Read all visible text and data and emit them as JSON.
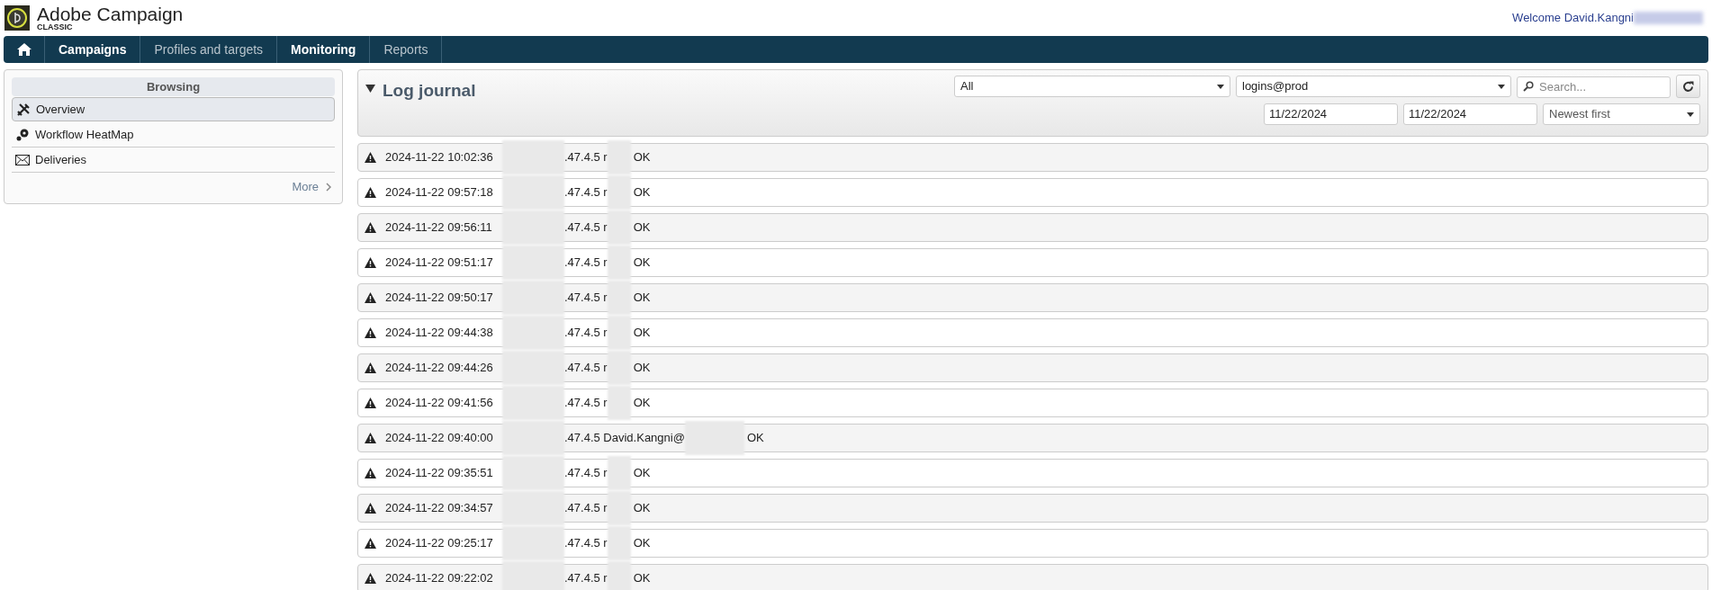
{
  "app": {
    "name": "Adobe Campaign",
    "edition": "CLASSIC"
  },
  "welcome": "Welcome David.Kangni",
  "nav": [
    {
      "kind": "home"
    },
    {
      "label": "Campaigns",
      "active": true
    },
    {
      "label": "Profiles and targets",
      "active": false
    },
    {
      "label": "Monitoring",
      "active": true
    },
    {
      "label": "Reports",
      "active": false
    }
  ],
  "sidebar": {
    "title": "Browsing",
    "items": [
      {
        "kind": "tools",
        "label": "Overview",
        "selected": true
      },
      {
        "kind": "gears",
        "label": "Workflow HeatMap",
        "selected": false
      },
      {
        "kind": "mail",
        "label": "Deliveries",
        "selected": false
      }
    ],
    "more": "More"
  },
  "journal": {
    "title": "Log journal",
    "expanded": true,
    "filter": "All",
    "account": "logins@prod",
    "search": {
      "placeholder": "Search..."
    },
    "date_from": "11/22/2024",
    "date_to": "11/22/2024",
    "sort": "Newest first",
    "rows": [
      {
        "time": "2024-11-22 10:02:36",
        "source": ".47.4.5 r",
        "status": "OK"
      },
      {
        "time": "2024-11-22 09:57:18",
        "source": ".47.4.5 r",
        "status": "OK"
      },
      {
        "time": "2024-11-22 09:56:11",
        "source": ".47.4.5 r",
        "status": "OK"
      },
      {
        "time": "2024-11-22 09:51:17",
        "source": ".47.4.5 r",
        "status": "OK"
      },
      {
        "time": "2024-11-22 09:50:17",
        "source": ".47.4.5 r",
        "status": "OK"
      },
      {
        "time": "2024-11-22 09:44:38",
        "source": ".47.4.5 r",
        "status": "OK"
      },
      {
        "time": "2024-11-22 09:44:26",
        "source": ".47.4.5 r",
        "status": "OK"
      },
      {
        "time": "2024-11-22 09:41:56",
        "source": ".47.4.5 r",
        "status": "OK"
      },
      {
        "time": "2024-11-22 09:40:00",
        "source": ".47.4.5 David.Kangni@",
        "status": "OK"
      },
      {
        "time": "2024-11-22 09:35:51",
        "source": ".47.4.5 r",
        "status": "OK"
      },
      {
        "time": "2024-11-22 09:34:57",
        "source": ".47.4.5 r",
        "status": "OK"
      },
      {
        "time": "2024-11-22 09:25:17",
        "source": ".47.4.5 r",
        "status": "OK"
      },
      {
        "time": "2024-11-22 09:22:02",
        "source": ".47.4.5 r",
        "status": "OK"
      }
    ]
  }
}
